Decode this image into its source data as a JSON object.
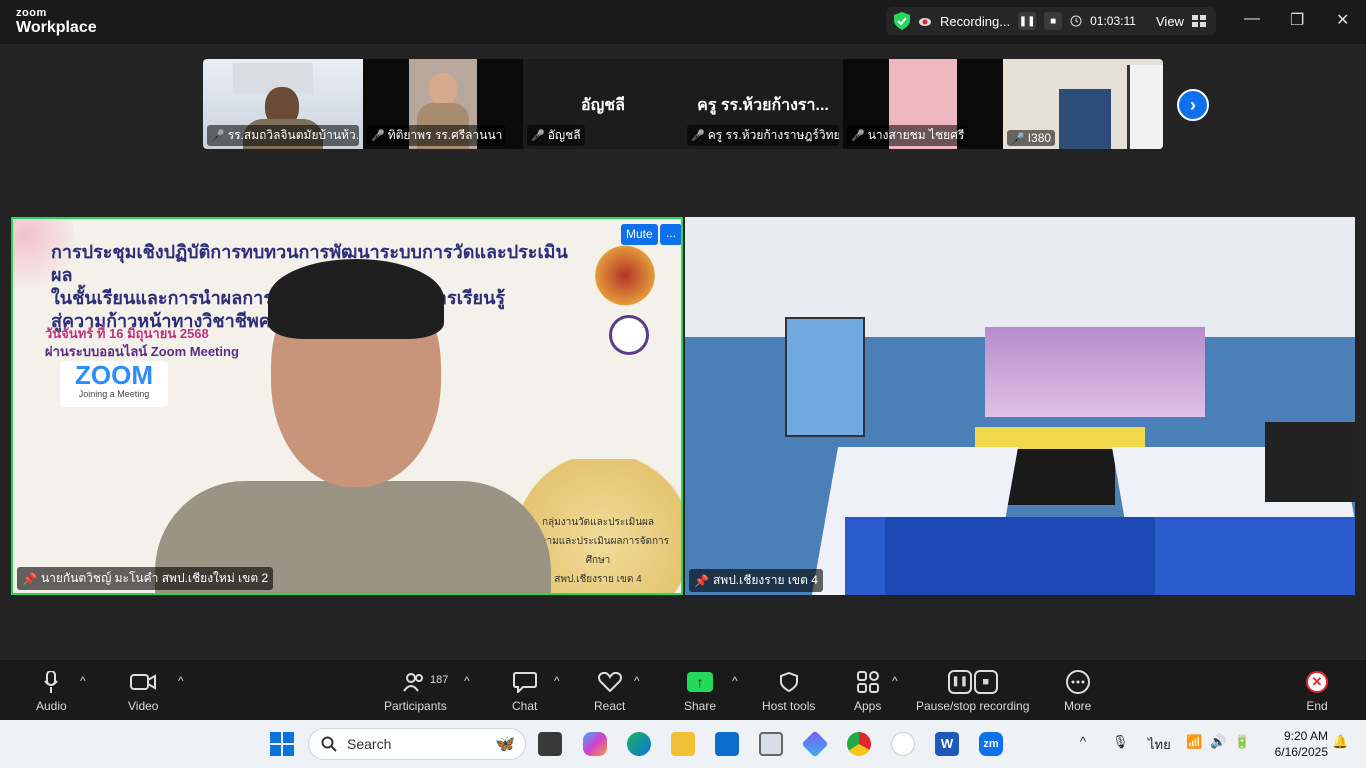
{
  "app": {
    "brand_small": "zoom",
    "brand_big": "Workplace"
  },
  "recording": {
    "label": "Recording...",
    "timer": "01:03:11",
    "view_label": "View"
  },
  "thumbnails": [
    {
      "name": "รร.สมถวิลจินตมัยบ้านห้ว...",
      "muted": true,
      "big_text": ""
    },
    {
      "name": "ทิติยาพร รร.ศรีลานนา",
      "muted": true,
      "big_text": ""
    },
    {
      "name": "อัญชลี",
      "muted": true,
      "big_text": "อัญชลี"
    },
    {
      "name": "ครู รร.ห้วยก้างราษฎร์วิทยา",
      "muted": true,
      "big_text": "ครู รร.ห้วยก้างรา..."
    },
    {
      "name": "นางสายชม  ไชยศรี",
      "muted": true,
      "big_text": ""
    },
    {
      "name": "I380",
      "muted": true,
      "big_text": ""
    }
  ],
  "main_left": {
    "slide_title_1": "การประชุมเชิงปฏิบัติการทบทวนการพัฒนาระบบการวัดและประเมินผล",
    "slide_title_2": "ในชั้นเรียนและการนำผลการประเมินไปใช้พัฒนาการเรียนรู้",
    "slide_title_3": "สู่ความก้าวหน้าทางวิชาชีพครู",
    "slide_date": "วันจันทร์ ที่ 16 มิถุนายน 2568",
    "slide_via": "ผ่านระบบออนไลน์ Zoom Meeting",
    "zoom_logo": "ZOOM",
    "zoom_sub": "Joining a Meeting",
    "gold_line_1": "กลุ่มงานวัดและประเมินผล",
    "gold_line_2": "ติดตามและประเมินผลการจัดการศึกษา",
    "gold_line_3": "สพป.เชียงราย เขต 4",
    "mute_label": "Mute",
    "more_label": "...",
    "name": "นายกันตวิชญ์  มะโนคำ สพป.เชียงใหม่ เขต 2"
  },
  "main_right": {
    "name": "สพป.เชียงราย เขต 4"
  },
  "toolbar": {
    "audio": "Audio",
    "video": "Video",
    "participants": "Participants",
    "participants_count": "187",
    "chat": "Chat",
    "react": "React",
    "share": "Share",
    "host_tools": "Host tools",
    "apps": "Apps",
    "pause_stop": "Pause/stop recording",
    "more": "More",
    "end": "End"
  },
  "taskbar": {
    "search_placeholder": "Search",
    "lang": "ไทย",
    "time": "9:20 AM",
    "date": "6/16/2025"
  },
  "colors": {
    "accent_blue": "#0e71eb",
    "active_speaker": "#23d959",
    "muted_red": "#e0282e"
  }
}
